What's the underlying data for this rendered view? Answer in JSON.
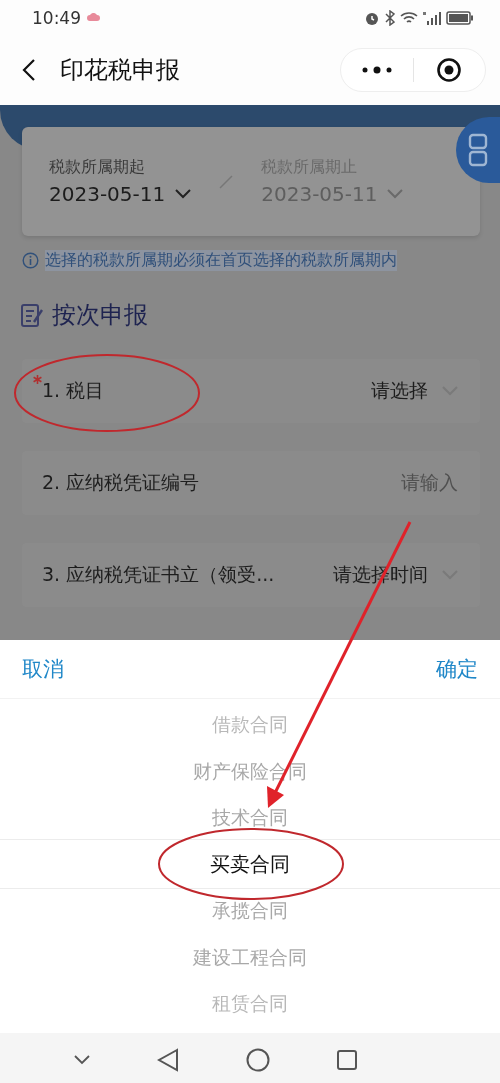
{
  "status_bar": {
    "time": "10:49"
  },
  "nav": {
    "title": "印花税申报"
  },
  "date_range": {
    "start": {
      "label": "税款所属期起",
      "value": "2023-05-11",
      "disabled": false
    },
    "end": {
      "label": "税款所属期止",
      "value": "2023-05-11",
      "disabled": true
    }
  },
  "notice": "选择的税款所属期必须在首页选择的税款所属期内",
  "section_title": "按次申报",
  "form_rows": [
    {
      "kind": "select",
      "label": "1. 税目",
      "required": true,
      "placeholder": "请选择"
    },
    {
      "kind": "input",
      "label": "2. 应纳税凭证编号",
      "required": false,
      "placeholder": "请输入"
    },
    {
      "kind": "select",
      "label": "3. 应纳税凭证书立（领受...",
      "required": false,
      "placeholder": "请选择时间"
    }
  ],
  "picker": {
    "cancel": "取消",
    "confirm": "确定",
    "options": [
      {
        "label": "借款合同",
        "selected": false
      },
      {
        "label": "财产保险合同",
        "selected": false
      },
      {
        "label": "技术合同",
        "selected": false
      },
      {
        "label": "买卖合同",
        "selected": true
      },
      {
        "label": "承揽合同",
        "selected": false
      },
      {
        "label": "建设工程合同",
        "selected": false
      },
      {
        "label": "租赁合同",
        "selected": false
      }
    ]
  }
}
